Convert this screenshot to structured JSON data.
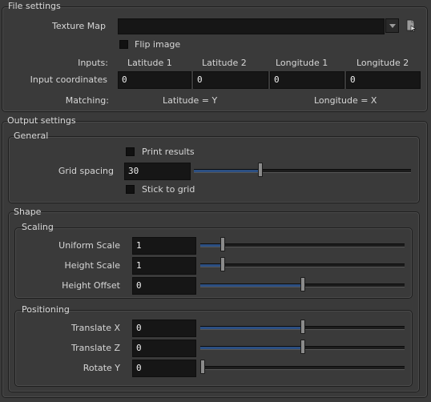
{
  "file_settings": {
    "title": "File settings",
    "texture_map_label": "Texture Map",
    "texture_map_value": "",
    "flip_image_label": "Flip image",
    "inputs_label": "Inputs:",
    "columns": [
      "Latitude 1",
      "Latitude 2",
      "Longitude 1",
      "Longitude 2"
    ],
    "input_coordinates_label": "Input coordinates",
    "input_values": [
      "0",
      "0",
      "0",
      "0"
    ],
    "matching_label": "Matching:",
    "matching_latitude": "Latitude = Y",
    "matching_longitude": "Longitude = X"
  },
  "output_settings": {
    "title": "Output settings",
    "general": {
      "title": "General",
      "print_results_label": "Print results",
      "grid_spacing_label": "Grid spacing",
      "grid_spacing_value": "30",
      "grid_spacing_slider_fraction": 0.3,
      "stick_to_grid_label": "Stick to grid"
    },
    "shape": {
      "title": "Shape",
      "scaling": {
        "title": "Scaling",
        "rows": [
          {
            "label": "Uniform Scale",
            "value": "1",
            "slider_fraction": 0.1
          },
          {
            "label": "Height Scale",
            "value": "1",
            "slider_fraction": 0.1
          },
          {
            "label": "Height Offset",
            "value": "0",
            "slider_fraction": 0.5
          }
        ]
      },
      "positioning": {
        "title": "Positioning",
        "rows": [
          {
            "label": "Translate X",
            "value": "0",
            "slider_fraction": 0.5
          },
          {
            "label": "Translate Z",
            "value": "0",
            "slider_fraction": 0.5
          },
          {
            "label": "Rotate Y",
            "value": "0",
            "slider_fraction": 0.0
          }
        ]
      }
    }
  },
  "colors": {
    "slider_fill": "#2c4f82",
    "background": "#3a3a3a",
    "field_bg": "#161616"
  },
  "icons": {
    "browse": "file-browse-icon",
    "dropdown": "chevron-down-icon"
  }
}
